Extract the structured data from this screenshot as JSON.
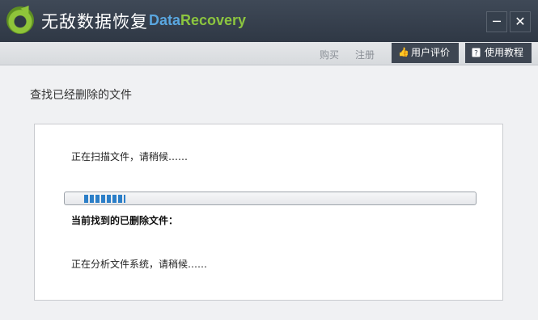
{
  "title_bar": {
    "app_name_cn": "无敌数据恢复",
    "app_name_en_part1": "Data",
    "app_name_en_part2": "Recovery",
    "minimize_glyph": "─",
    "close_glyph": "✕",
    "logo_icon": "circular-arrow-logo-icon"
  },
  "toolbar": {
    "buy_label": "购买",
    "register_label": "注册",
    "reviews_label": "用户评价",
    "reviews_icon": "thumbs-up-icon",
    "tutorial_label": "使用教程",
    "tutorial_icon": "help-book-icon"
  },
  "main": {
    "heading": "查找已经删除的文件",
    "scan_status": "正在扫描文件，请稍候……",
    "progress": 0.1,
    "found_label": "当前找到的已删除文件：",
    "analyze_status": "正在分析文件系统，请稍候……"
  },
  "colors": {
    "title_bg": "#343d4a",
    "accent_blue": "#5aa7e0",
    "accent_green": "#8cc53f",
    "progress_fill": "#2c7fc8"
  }
}
